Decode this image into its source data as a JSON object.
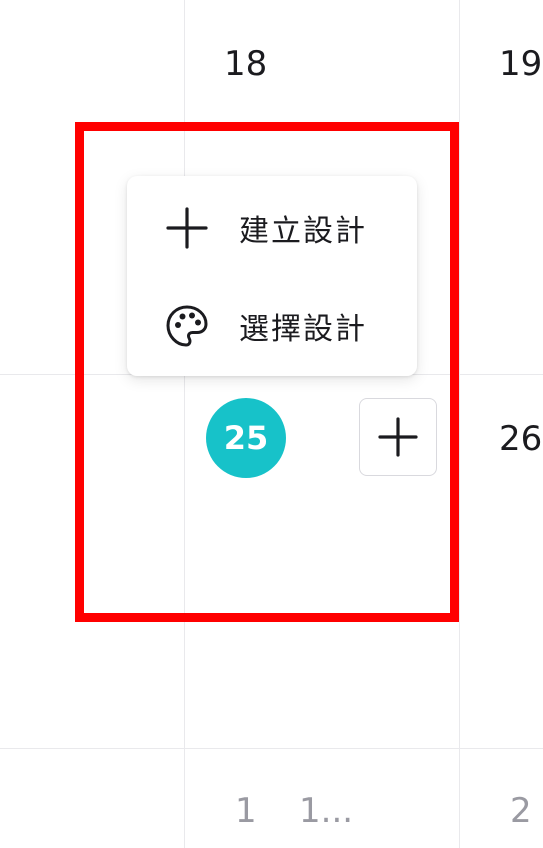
{
  "calendar": {
    "week1": {
      "day_a": "18",
      "day_b": "19"
    },
    "week2": {
      "today": "25",
      "day_b": "26"
    },
    "footer": {
      "cell_a_1": "1",
      "cell_a_2": "1...",
      "cell_b": "2"
    }
  },
  "popup_menu": {
    "items": [
      {
        "label": "建立設計",
        "icon": "plus-icon"
      },
      {
        "label": "選擇設計",
        "icon": "palette-icon"
      }
    ]
  },
  "colors": {
    "today_badge": "#17c2c9",
    "highlight": "#ff0000",
    "grid": "#e9e9ec",
    "muted_text": "#9a9aa2"
  }
}
